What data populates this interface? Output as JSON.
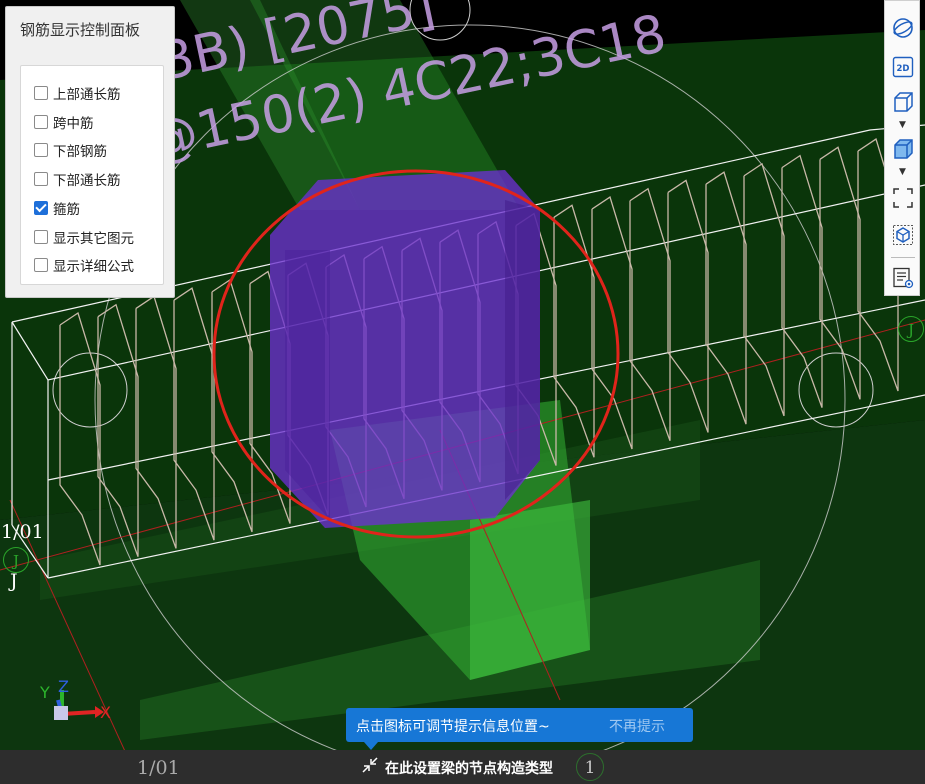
{
  "viewport": {
    "annotation_line1": "3B) [2075]",
    "annotation_line2": "@150(2) 4C22;3C18",
    "axis_left_label": "1/01",
    "axis_j_label": "J",
    "axis_bottom_label": "1/01",
    "axis_bottom_number": "1",
    "axis_triad": {
      "x_label": "X",
      "y_label": "Y",
      "z_label": "Z"
    }
  },
  "panel": {
    "title": "钢筋显示控制面板",
    "options": [
      {
        "label": "上部通长筋",
        "checked": false
      },
      {
        "label": "跨中筋",
        "checked": false
      },
      {
        "label": "下部钢筋",
        "checked": false
      },
      {
        "label": "下部通长筋",
        "checked": false
      },
      {
        "label": "箍筋",
        "checked": true
      },
      {
        "label": "显示其它图元",
        "checked": false
      },
      {
        "label": "显示详细公式",
        "checked": false
      }
    ]
  },
  "toolbar": {
    "view_2d_label": "2D",
    "items": [
      "orbit-icon",
      "view-2d-icon",
      "wireframe-box-icon",
      "solid-box-icon",
      "fit-view-icon",
      "element-view-icon",
      "detail-list-icon"
    ]
  },
  "tip": {
    "message": "点击图标可调节提示信息位置~",
    "dismiss_label": "不再提示"
  },
  "status": {
    "node_setting_text": "在此设置梁的节点构造类型"
  },
  "colors": {
    "background": "#000000",
    "green_column": "#2f9a2f",
    "purple_node": "#6a2fc0",
    "highlight_circle": "#e0241b",
    "tip_blue": "#1777d6"
  }
}
